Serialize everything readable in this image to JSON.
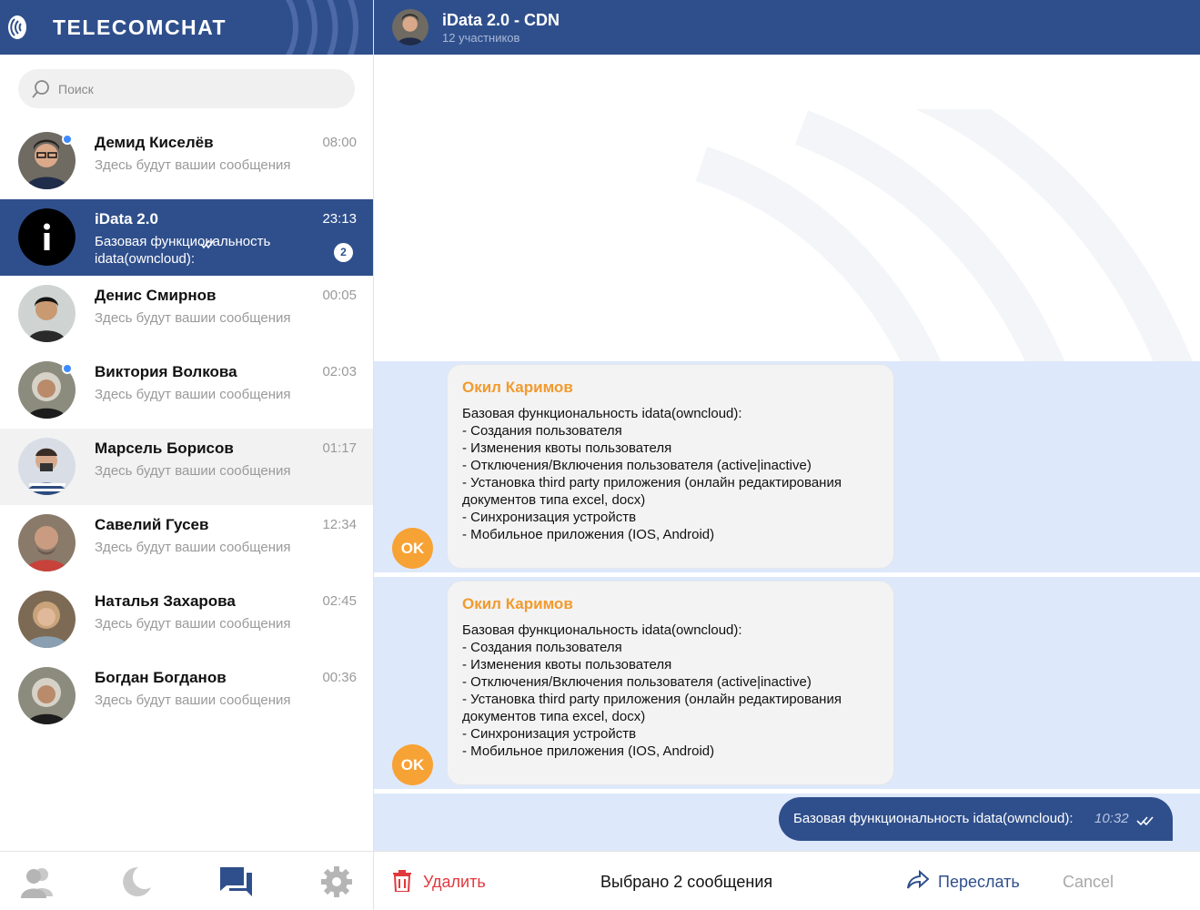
{
  "brand": {
    "name": "TELECOMCHAT"
  },
  "search": {
    "placeholder": "Поиск"
  },
  "chats": [
    {
      "name": "Демид Киселёв",
      "preview": "Здесь будут вашии сообщения",
      "time": "08:00",
      "online": true
    },
    {
      "name": "iData 2.0",
      "preview": "Базовая функциональность idata(owncloud):",
      "time": "23:13",
      "unread": "2",
      "active": true
    },
    {
      "name": "Денис Смирнов",
      "preview": "Здесь будут вашии сообщения",
      "time": "00:05"
    },
    {
      "name": "Виктория Волкова",
      "preview": "Здесь будут вашии сообщения",
      "time": "02:03",
      "online": true
    },
    {
      "name": "Марсель Борисов",
      "preview": "Здесь будут вашии сообщения",
      "time": "01:17"
    },
    {
      "name": "Савелий Гусев",
      "preview": "Здесь будут вашии сообщения",
      "time": "12:34"
    },
    {
      "name": "Наталья Захарова",
      "preview": "Здесь будут вашии сообщения",
      "time": "02:45"
    },
    {
      "name": "Богдан Богданов",
      "preview": "Здесь будут вашии сообщения",
      "time": "00:36"
    }
  ],
  "header": {
    "title": "iData 2.0 - CDN",
    "subtitle": "12 участников"
  },
  "messages": [
    {
      "sender": "Окил Каримов",
      "initials": "OK",
      "body": "Базовая функциональность idata(owncloud):\n- Создания пользователя\n- Изменения квоты пользователя\n- Отключения/Включения пользователя (active|inactive)\n- Установка third party приложения (онлайн редактирования документов типа excel, docx)\n- Синхронизация устройств\n- Мобильное приложения (IOS, Android)"
    },
    {
      "sender": "Окил Каримов",
      "initials": "OK",
      "body": "Базовая функциональность idata(owncloud):\n- Создания пользователя\n- Изменения квоты пользователя\n- Отключения/Включения пользователя (active|inactive)\n- Установка third party приложения (онлайн редактирования документов типа excel, docx)\n- Синхронизация устройств\n- Мобильное приложения (IOS, Android)"
    }
  ],
  "own_message": {
    "text": "Базовая функциональность idata(owncloud):",
    "time": "10:32"
  },
  "actions": {
    "delete_label": "Удалить",
    "selected_label": "Выбрано 2 сообщения",
    "forward_label": "Переслать",
    "cancel_label": "Cancel"
  },
  "colors": {
    "brand": "#2f4f8c",
    "accent": "#f7a234",
    "selection": "#dde8fb",
    "danger": "#e0393e"
  }
}
